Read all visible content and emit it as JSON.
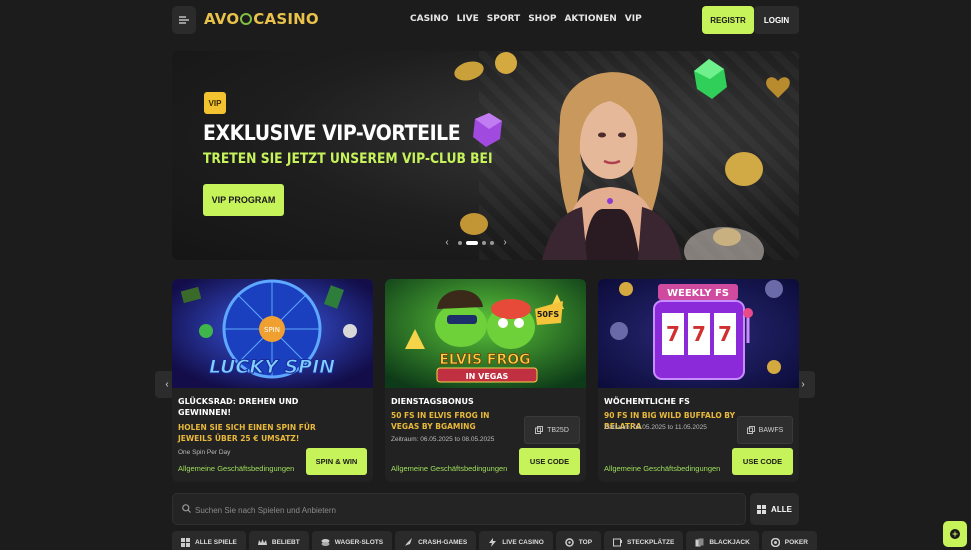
{
  "header": {
    "logo_text_left": "AVO",
    "logo_text_right": "CASINO",
    "nav": [
      "CASINO",
      "LIVE",
      "SPORT",
      "SHOP",
      "AKTIONEN",
      "VIP"
    ],
    "register_label": "REGISTR",
    "login_label": "LOGIN"
  },
  "hero": {
    "badge": "VIP",
    "title": "EXKLUSIVE VIP-VORTEILE",
    "subtitle": "TRETEN SIE JETZT UNSEREM VIP-CLUB BEI",
    "cta": "VIP PROGRAM",
    "slides_total": 4,
    "active_slide": 2
  },
  "cards": [
    {
      "title": "GLÜCKSRAD: DREHEN UND GEWINNEN!",
      "highlight": "HOLEN SIE SICH EINEN SPIN FÜR JEWEILS ÜBER 25 € UMSATZ!",
      "small": "One Spin Per Day",
      "image_text": "LUCKY SPIN",
      "terms": "Allgemeine Geschäftsbedingungen",
      "button": "SPIN & WIN"
    },
    {
      "title": "DIENSTAGSBONUS",
      "highlight": "50 FS IN ELVIS FROG IN VEGAS BY BGAMING",
      "small": "Zeitraum: 06.05.2025 to 08.05.2025",
      "image_text": "ELVIS FROG",
      "image_subtext": "IN VEGAS",
      "image_badge": "50FS",
      "code": "TB25D",
      "terms": "Allgemeine Geschäftsbedingungen",
      "button": "USE CODE"
    },
    {
      "title": "WÖCHENTLICHE FS",
      "highlight": "90 FS IN BIG WILD BUFFALO BY BELATRA",
      "small": "Zeitraum: 05.05.2025 to 11.05.2025",
      "image_text": "WEEKLY FS",
      "code": "BAWFS",
      "terms": "Allgemeine Geschäftsbedingungen",
      "button": "USE CODE"
    }
  ],
  "search": {
    "placeholder": "Suchen Sie nach Spielen und Anbietern",
    "all_label": "ALLE"
  },
  "categories": [
    "ALLE SPIELE",
    "BELIEBT",
    "WAGER-SLOTS",
    "CRASH-GAMES",
    "LIVE CASINO",
    "TOP",
    "STECKPLÄTZE",
    "BLACKJACK",
    "POKER"
  ],
  "colors": {
    "accent": "#c6f25a",
    "gold": "#e8b93a",
    "bg": "#1c1c1c",
    "card": "#222222"
  }
}
